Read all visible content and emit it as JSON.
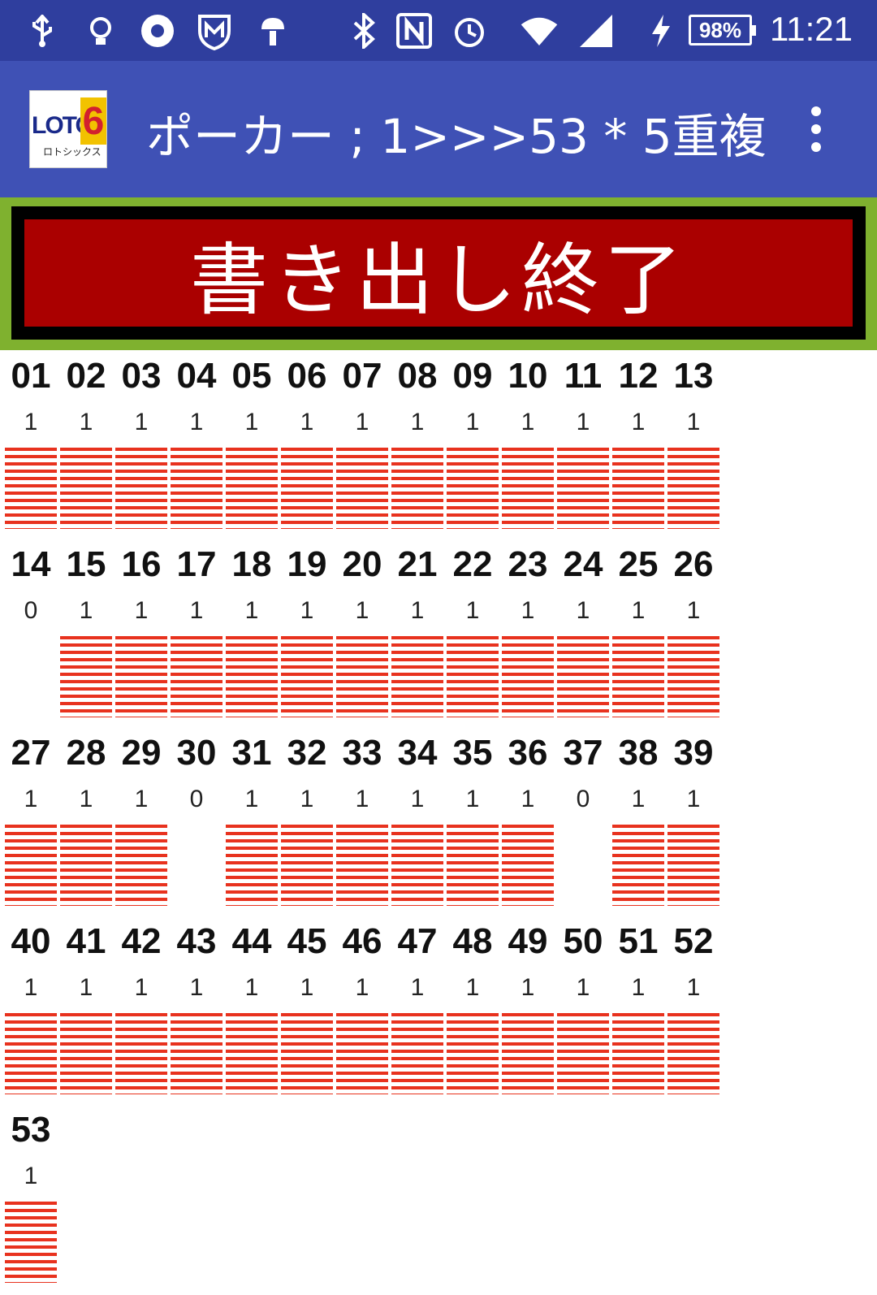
{
  "status_bar": {
    "icons": [
      "usb-icon",
      "lightbulb-icon",
      "chrome-icon",
      "shield-icon",
      "android-icon",
      "bluetooth-icon",
      "nfc-icon",
      "alarm-icon",
      "wifi-icon",
      "signal-icon",
      "charging-icon"
    ],
    "battery": "98%",
    "time": "11:21"
  },
  "app_bar": {
    "logo_text": "LOTO",
    "logo_number": "6",
    "logo_sub": "ロトシックス",
    "title": "ポーカー ; 1>>>53 * 5重複 [..."
  },
  "action": {
    "label": "書き出し終了"
  },
  "colors": {
    "bar": "#e8321e",
    "button": "#aa0000",
    "frame": "#7fb12f",
    "app_bar": "#3f51b5"
  },
  "numbers": [
    {
      "num": "01",
      "count": "1"
    },
    {
      "num": "02",
      "count": "1"
    },
    {
      "num": "03",
      "count": "1"
    },
    {
      "num": "04",
      "count": "1"
    },
    {
      "num": "05",
      "count": "1"
    },
    {
      "num": "06",
      "count": "1"
    },
    {
      "num": "07",
      "count": "1"
    },
    {
      "num": "08",
      "count": "1"
    },
    {
      "num": "09",
      "count": "1"
    },
    {
      "num": "10",
      "count": "1"
    },
    {
      "num": "11",
      "count": "1"
    },
    {
      "num": "12",
      "count": "1"
    },
    {
      "num": "13",
      "count": "1"
    },
    {
      "num": "14",
      "count": "0"
    },
    {
      "num": "15",
      "count": "1"
    },
    {
      "num": "16",
      "count": "1"
    },
    {
      "num": "17",
      "count": "1"
    },
    {
      "num": "18",
      "count": "1"
    },
    {
      "num": "19",
      "count": "1"
    },
    {
      "num": "20",
      "count": "1"
    },
    {
      "num": "21",
      "count": "1"
    },
    {
      "num": "22",
      "count": "1"
    },
    {
      "num": "23",
      "count": "1"
    },
    {
      "num": "24",
      "count": "1"
    },
    {
      "num": "25",
      "count": "1"
    },
    {
      "num": "26",
      "count": "1"
    },
    {
      "num": "27",
      "count": "1"
    },
    {
      "num": "28",
      "count": "1"
    },
    {
      "num": "29",
      "count": "1"
    },
    {
      "num": "30",
      "count": "0"
    },
    {
      "num": "31",
      "count": "1"
    },
    {
      "num": "32",
      "count": "1"
    },
    {
      "num": "33",
      "count": "1"
    },
    {
      "num": "34",
      "count": "1"
    },
    {
      "num": "35",
      "count": "1"
    },
    {
      "num": "36",
      "count": "1"
    },
    {
      "num": "37",
      "count": "0"
    },
    {
      "num": "38",
      "count": "1"
    },
    {
      "num": "39",
      "count": "1"
    },
    {
      "num": "40",
      "count": "1"
    },
    {
      "num": "41",
      "count": "1"
    },
    {
      "num": "42",
      "count": "1"
    },
    {
      "num": "43",
      "count": "1"
    },
    {
      "num": "44",
      "count": "1"
    },
    {
      "num": "45",
      "count": "1"
    },
    {
      "num": "46",
      "count": "1"
    },
    {
      "num": "47",
      "count": "1"
    },
    {
      "num": "48",
      "count": "1"
    },
    {
      "num": "49",
      "count": "1"
    },
    {
      "num": "50",
      "count": "1"
    },
    {
      "num": "51",
      "count": "1"
    },
    {
      "num": "52",
      "count": "1"
    },
    {
      "num": "53",
      "count": "1"
    }
  ]
}
